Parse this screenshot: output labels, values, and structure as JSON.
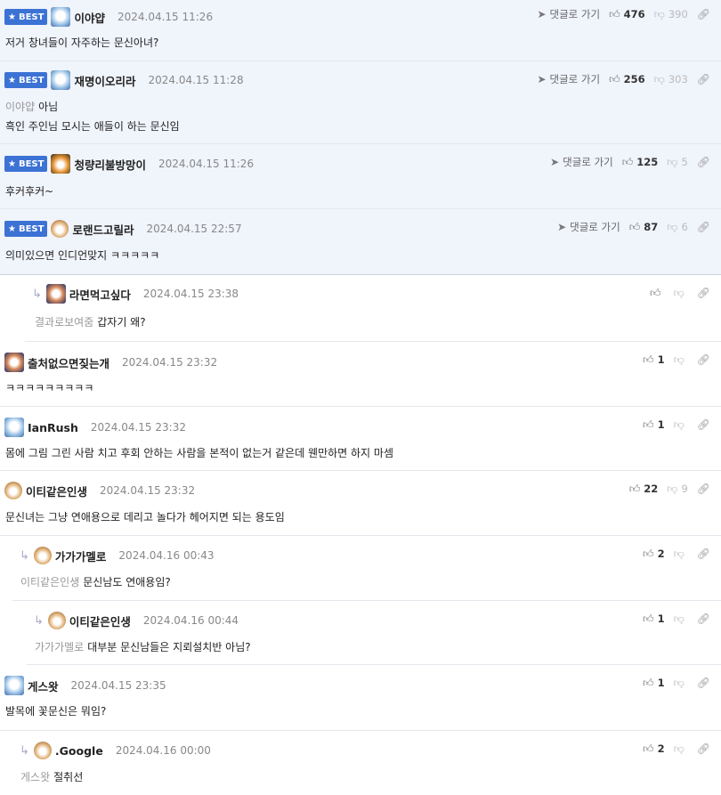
{
  "best_label": "BEST",
  "goto_label": "댓글로 가기",
  "comments": [
    {
      "nick": "이야얍",
      "date": "2024.04.15 11:26",
      "text": "저거 창녀들이 자주하는 문신아녀?",
      "reply_to": "",
      "up": "476",
      "down": "390",
      "best": true,
      "avatar": "eskimo-dog-avatar"
    },
    {
      "nick": "재명이오리라",
      "date": "2024.04.15 11:28",
      "text": "아님",
      "text2": "흑인 주인님 모시는 애들이 하는 문신임",
      "reply_to": "이야얍",
      "up": "256",
      "down": "303",
      "best": true,
      "avatar": "eskimo-dog-avatar"
    },
    {
      "nick": "청량리불방망이",
      "date": "2024.04.15 11:26",
      "text": "후커후커~",
      "reply_to": "",
      "up": "125",
      "down": "5",
      "best": true,
      "avatar": "corgi-avatar"
    },
    {
      "nick": "로랜드고릴라",
      "date": "2024.04.15 22:57",
      "text": "의미있으면 인디언맞지 ㅋㅋㅋㅋㅋ",
      "reply_to": "",
      "up": "87",
      "down": "6",
      "best": true,
      "avatar": "puppy-avatar"
    },
    {
      "nick": "라면먹고싶다",
      "date": "2024.04.15 23:38",
      "text": "갑자기 왜?",
      "reply_to": "결과로보여줌",
      "up": "",
      "down": "",
      "best": false,
      "avatar": "dark-dog-avatar"
    },
    {
      "nick": "출처없으면짖는개",
      "date": "2024.04.15 23:32",
      "text": "ㅋㅋㅋㅋㅋㅋㅋㅋㅋ",
      "reply_to": "",
      "up": "1",
      "down": "",
      "best": false,
      "avatar": "dark-dog-avatar"
    },
    {
      "nick": "IanRush",
      "date": "2024.04.15 23:32",
      "text": "몸에 그림 그린 사람 치고 후회 안하는 사람을 본적이 없는거 같은데 웬만하면 하지 마셈",
      "reply_to": "",
      "up": "1",
      "down": "",
      "best": false,
      "avatar": "eskimo-dog-avatar"
    },
    {
      "nick": "이티같은인생",
      "date": "2024.04.15 23:32",
      "text": "문신녀는 그냥 연애용으로 데리고 놀다가 헤어지면 되는 용도임",
      "reply_to": "",
      "up": "22",
      "down": "9",
      "best": false,
      "avatar": "puppy-avatar"
    },
    {
      "nick": "가가가멜로",
      "date": "2024.04.16 00:43",
      "text": "문신남도 연애용임?",
      "reply_to": "이티같은인생",
      "up": "2",
      "down": "",
      "best": false,
      "avatar": "puppy-avatar"
    },
    {
      "nick": "이티같은인생",
      "date": "2024.04.16 00:44",
      "text": "대부분 문신남들은 지뢰설치반 아님?",
      "reply_to": "가가가멜로",
      "up": "1",
      "down": "",
      "best": false,
      "avatar": "puppy-avatar"
    },
    {
      "nick": "게스왓",
      "date": "2024.04.15 23:35",
      "text": "발목에 꽃문신은 뭐임?",
      "reply_to": "",
      "up": "1",
      "down": "",
      "best": false,
      "avatar": "eskimo-dog-avatar"
    },
    {
      "nick": ".Google",
      "date": "2024.04.16 00:00",
      "text": "절취선",
      "reply_to": "게스왓",
      "up": "2",
      "down": "",
      "best": false,
      "avatar": "puppy-avatar"
    }
  ]
}
